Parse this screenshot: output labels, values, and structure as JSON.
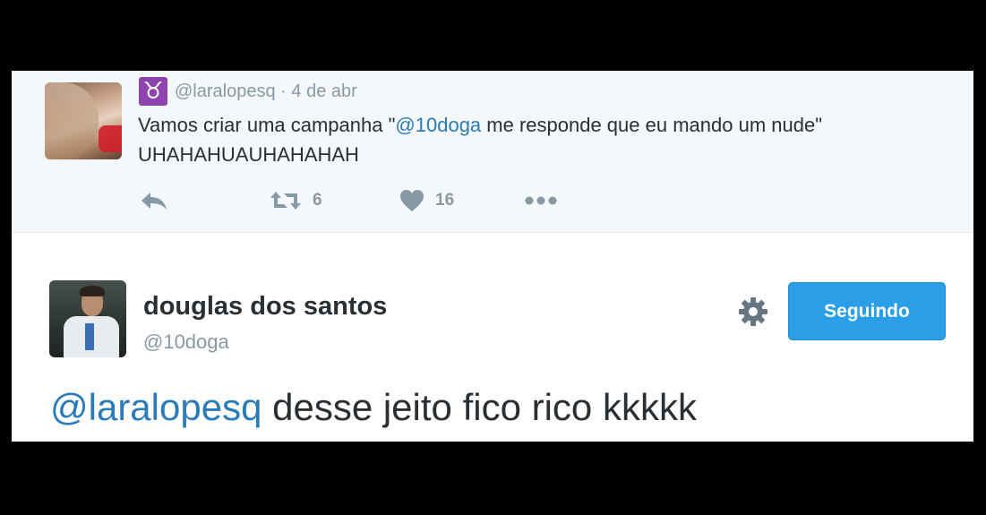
{
  "reply_tweet": {
    "username": "@laralopesq",
    "separator": "·",
    "date": "4 de abr",
    "text_before": "Vamos criar uma campanha \"",
    "mention": "@10doga",
    "text_after": " me responde que eu mando um nude\"",
    "text_line2": "UHAHAHUAUHAHAHAH",
    "badge_glyph": "♉",
    "retweets": "6",
    "likes": "16"
  },
  "main_tweet": {
    "name": "douglas dos santos",
    "handle": "@10doga",
    "follow_label": "Seguindo",
    "mention": "@laralopesq",
    "text": " desse jeito fico rico kkkkk"
  },
  "icons": {
    "reply": "reply-icon",
    "retweet": "retweet-icon",
    "like": "heart-icon",
    "more": "more-icon",
    "settings": "gear-icon",
    "badge": "taurus-icon"
  },
  "colors": {
    "link": "#2b7bb9",
    "button": "#2a9fe8",
    "muted": "#8899a6",
    "badge": "#8e44ad"
  }
}
